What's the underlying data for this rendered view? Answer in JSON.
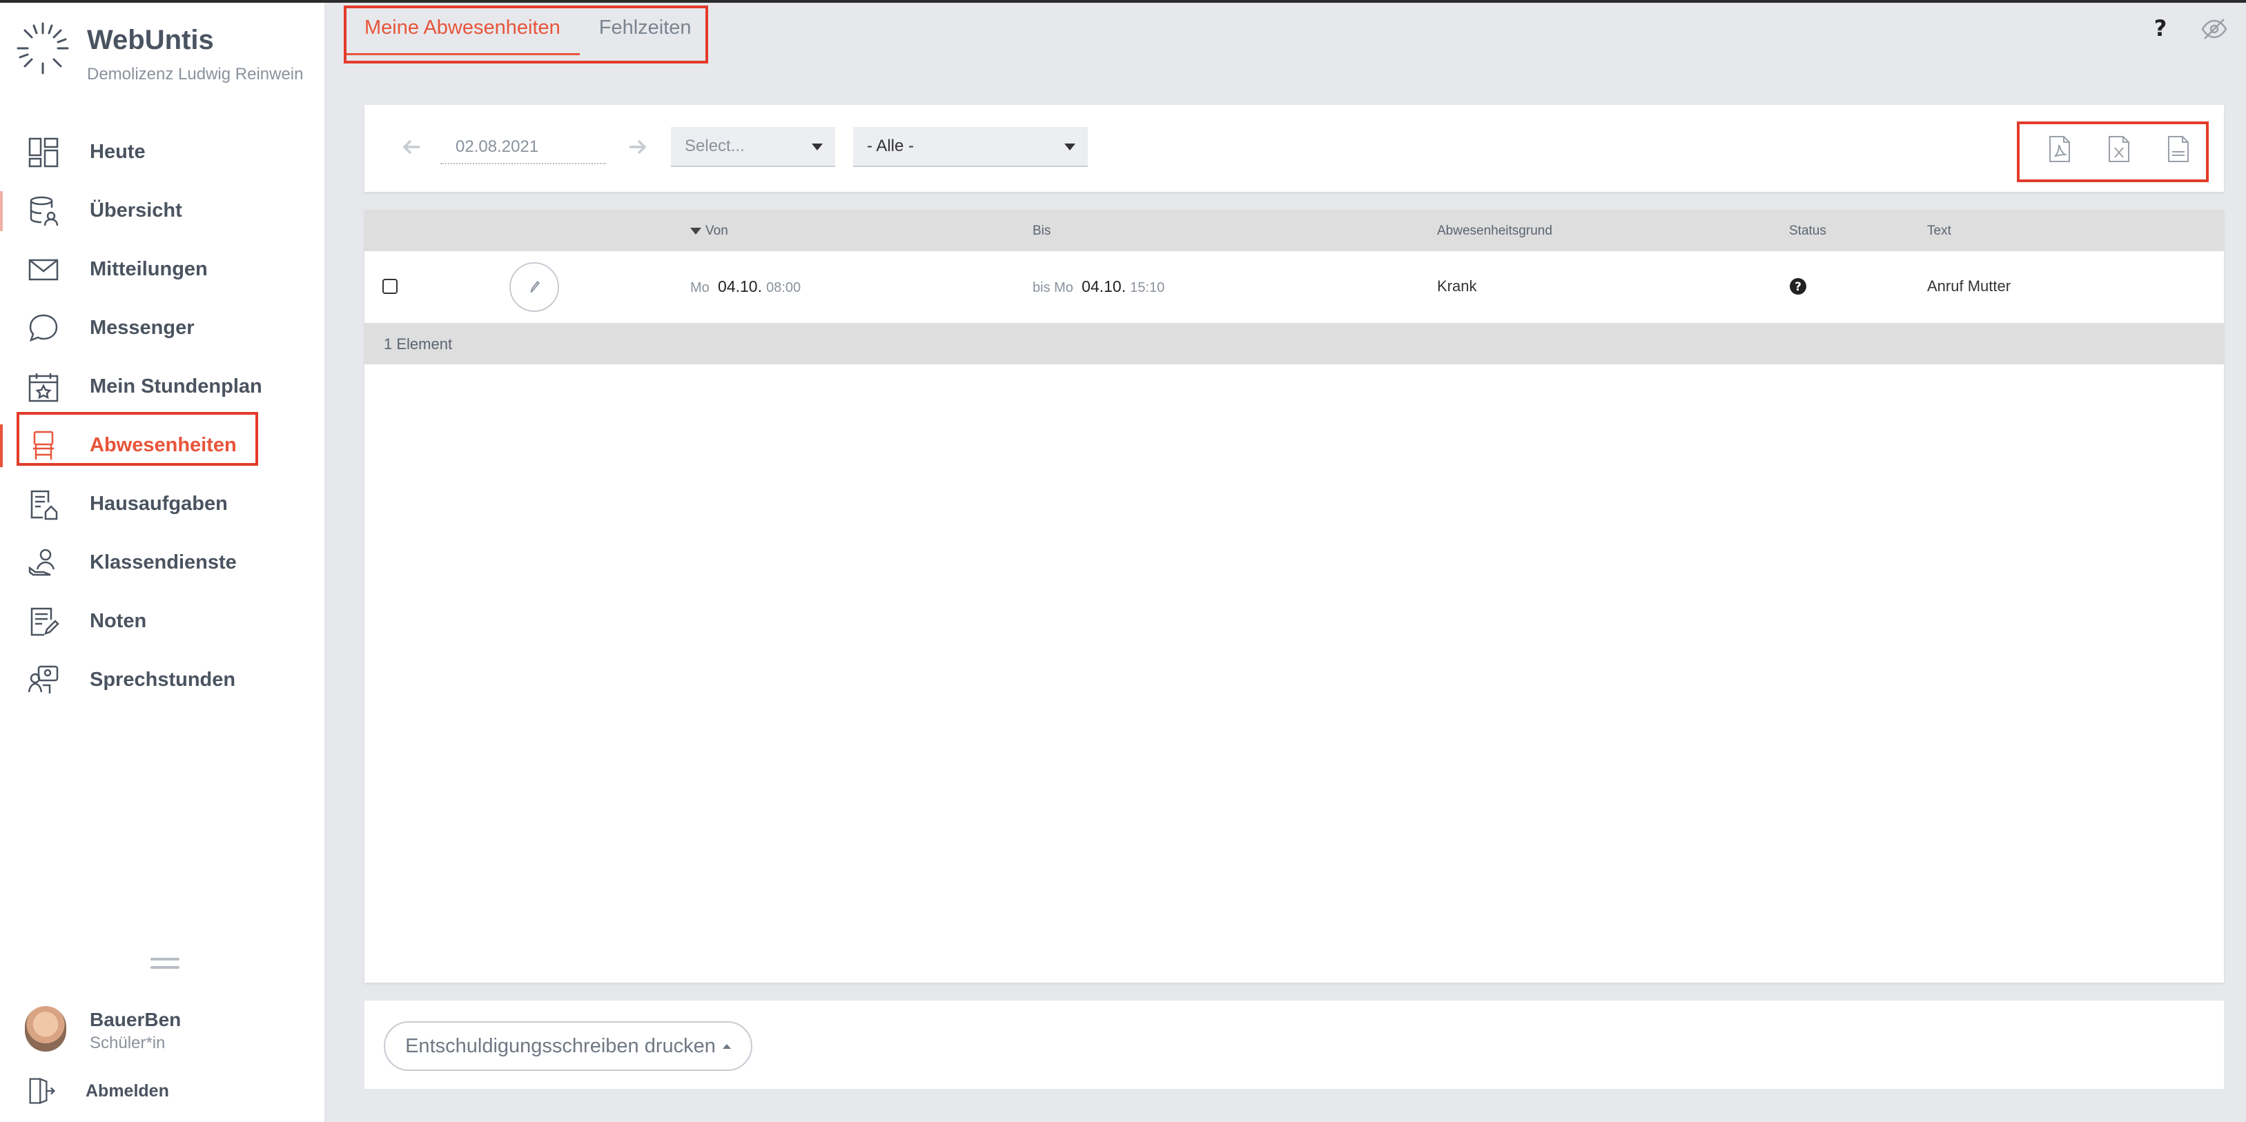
{
  "brand": {
    "name": "WebUntis",
    "subtitle": "Demolizenz Ludwig Reinwein"
  },
  "sidebar": {
    "items": [
      {
        "label": "Heute",
        "icon": "dashboard-icon"
      },
      {
        "label": "Übersicht",
        "icon": "database-user-icon"
      },
      {
        "label": "Mitteilungen",
        "icon": "envelope-icon"
      },
      {
        "label": "Messenger",
        "icon": "chat-bubble-icon"
      },
      {
        "label": "Mein Stundenplan",
        "icon": "calendar-star-icon"
      },
      {
        "label": "Abwesenheiten",
        "icon": "chair-icon",
        "active": true
      },
      {
        "label": "Hausaufgaben",
        "icon": "homework-icon"
      },
      {
        "label": "Klassendienste",
        "icon": "class-duty-icon"
      },
      {
        "label": "Noten",
        "icon": "grades-icon"
      },
      {
        "label": "Sprechstunden",
        "icon": "consultation-icon"
      }
    ]
  },
  "user": {
    "name": "BauerBen",
    "role": "Schüler*in",
    "logout_label": "Abmelden"
  },
  "tabs": [
    {
      "label": "Meine Abwesenheiten",
      "active": true
    },
    {
      "label": "Fehlzeiten",
      "active": false
    }
  ],
  "filter": {
    "date": "02.08.2021",
    "select_placeholder": "Select...",
    "status_select": "- Alle -"
  },
  "export": {
    "icons": [
      "pdf-export-icon",
      "excel-export-icon",
      "csv-export-icon"
    ]
  },
  "table": {
    "columns": {
      "from": "Von",
      "to": "Bis",
      "reason": "Abwesenheitsgrund",
      "status": "Status",
      "text": "Text"
    },
    "rows": [
      {
        "from_day": "Mo",
        "from_date": "04.10.",
        "from_time": "08:00",
        "to_prefix": "bis Mo",
        "to_date": "04.10.",
        "to_time": "15:10",
        "reason": "Krank",
        "status_icon": "question-circle-icon",
        "text": "Anruf Mutter"
      }
    ],
    "footer": "1 Element"
  },
  "actions": {
    "print_label": "Entschuldigungsschreiben drucken"
  },
  "colors": {
    "accent": "#e8543a",
    "highlight": "#e33b2b",
    "text": "#4a5360"
  }
}
